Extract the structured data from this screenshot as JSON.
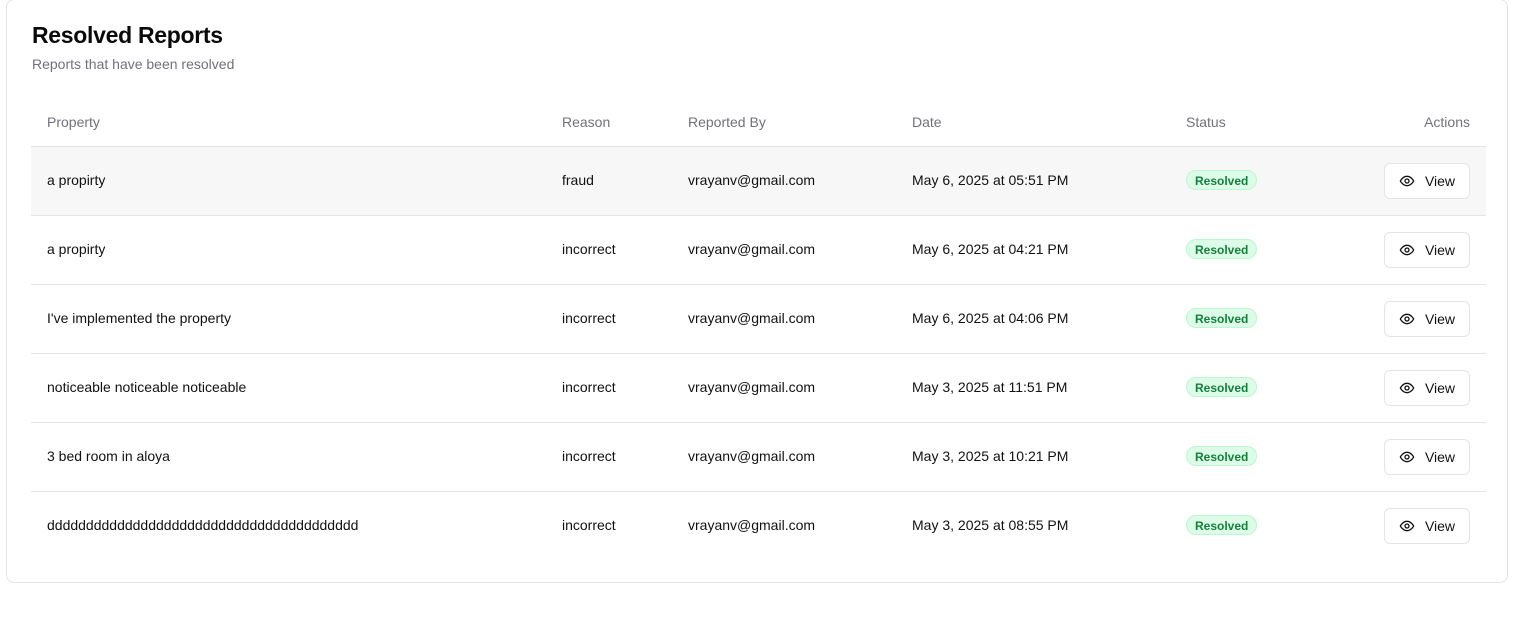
{
  "header": {
    "title": "Resolved Reports",
    "subtitle": "Reports that have been resolved"
  },
  "table": {
    "columns": {
      "property": "Property",
      "reason": "Reason",
      "reported_by": "Reported By",
      "date": "Date",
      "status": "Status",
      "actions": "Actions"
    },
    "rows": [
      {
        "property": "a propirty",
        "reason": "fraud",
        "reported_by": "vrayanv@gmail.com",
        "date": "May 6, 2025 at 05:51 PM",
        "status": "Resolved",
        "action_label": "View"
      },
      {
        "property": "a propirty",
        "reason": "incorrect",
        "reported_by": "vrayanv@gmail.com",
        "date": "May 6, 2025 at 04:21 PM",
        "status": "Resolved",
        "action_label": "View"
      },
      {
        "property": "I've implemented the property",
        "reason": "incorrect",
        "reported_by": "vrayanv@gmail.com",
        "date": "May 6, 2025 at 04:06 PM",
        "status": "Resolved",
        "action_label": "View"
      },
      {
        "property": "noticeable noticeable noticeable",
        "reason": "incorrect",
        "reported_by": "vrayanv@gmail.com",
        "date": "May 3, 2025 at 11:51 PM",
        "status": "Resolved",
        "action_label": "View"
      },
      {
        "property": "3 bed room in aloya",
        "reason": "incorrect",
        "reported_by": "vrayanv@gmail.com",
        "date": "May 3, 2025 at 10:21 PM",
        "status": "Resolved",
        "action_label": "View"
      },
      {
        "property": "dddddddddddddddddddddddddddddddddddddddd",
        "reason": "incorrect",
        "reported_by": "vrayanv@gmail.com",
        "date": "May 3, 2025 at 08:55 PM",
        "status": "Resolved",
        "action_label": "View"
      }
    ]
  },
  "icons": {
    "view": "eye-icon"
  },
  "colors": {
    "status_resolved_bg": "#dcfce7",
    "status_resolved_text": "#15803d",
    "row_hover_bg": "#f7f7f7"
  }
}
